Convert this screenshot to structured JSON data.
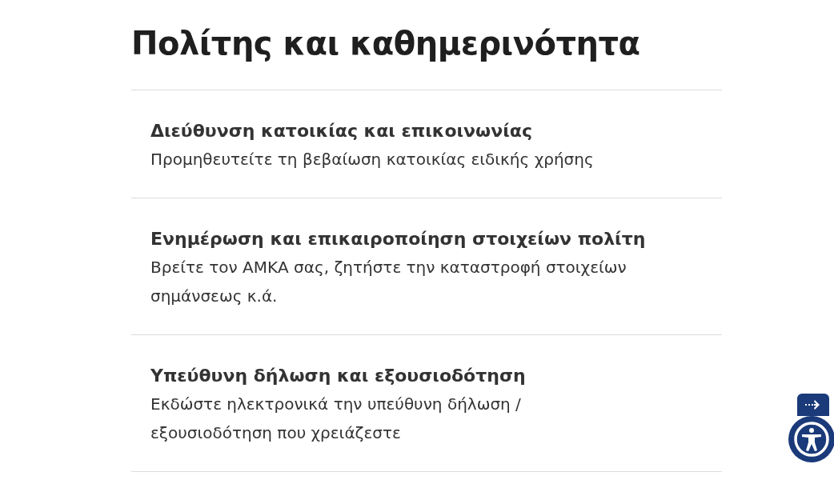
{
  "title": "Πολίτης και καθημερινότητα",
  "items": [
    {
      "title": "Διεύθυνση κατοικίας και επικοινωνίας",
      "description": "Προμηθευτείτε τη βεβαίωση κατοικίας ειδικής χρήσης"
    },
    {
      "title": "Ενημέρωση και επικαιροποίηση στοιχείων πολίτη",
      "description": "Βρείτε τον ΑΜΚΑ σας, ζητήστε την καταστροφή στοιχείων σημάνσεως κ.ά."
    },
    {
      "title": "Υπεύθυνη δήλωση και εξουσιοδότηση",
      "description": "Εκδώστε ηλεκτρονικά την υπεύθυνη δήλωση / εξουσιοδότηση που χρειάζεστε"
    }
  ]
}
